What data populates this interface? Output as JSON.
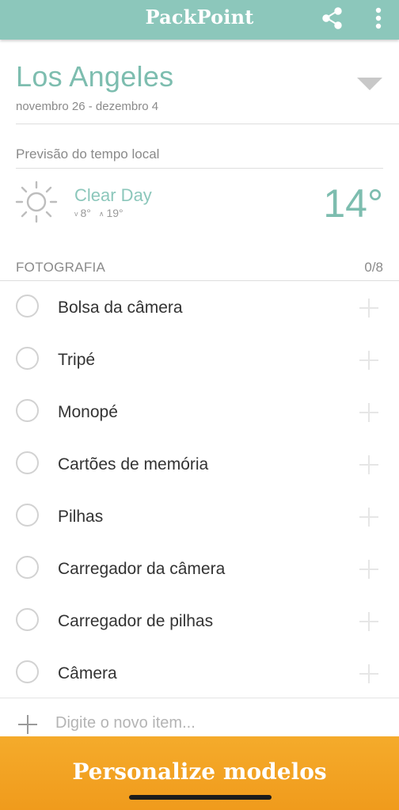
{
  "app": {
    "title": "PackPoint"
  },
  "trip": {
    "destination": "Los Angeles",
    "dates": "novembro 26 - dezembro 4"
  },
  "weather": {
    "header": "Previsão do tempo local",
    "condition": "Clear Day",
    "low": "8°",
    "high": "19°",
    "temperature": "14°",
    "icon": "sun-icon"
  },
  "category": {
    "name": "FOTOGRAFIA",
    "count": "0/8",
    "items": [
      {
        "label": "Bolsa da câmera"
      },
      {
        "label": "Tripé"
      },
      {
        "label": "Monopé"
      },
      {
        "label": "Cartões de memória"
      },
      {
        "label": "Pilhas"
      },
      {
        "label": "Carregador da câmera"
      },
      {
        "label": "Carregador de pilhas"
      },
      {
        "label": "Câmera"
      }
    ]
  },
  "add_item": {
    "placeholder": "Digite o novo item..."
  },
  "footer": {
    "button_label": "Personalize modelos"
  },
  "colors": {
    "header": "#8cc7bb",
    "accent": "#7dbdaf",
    "footer": "#f5ab2b"
  }
}
